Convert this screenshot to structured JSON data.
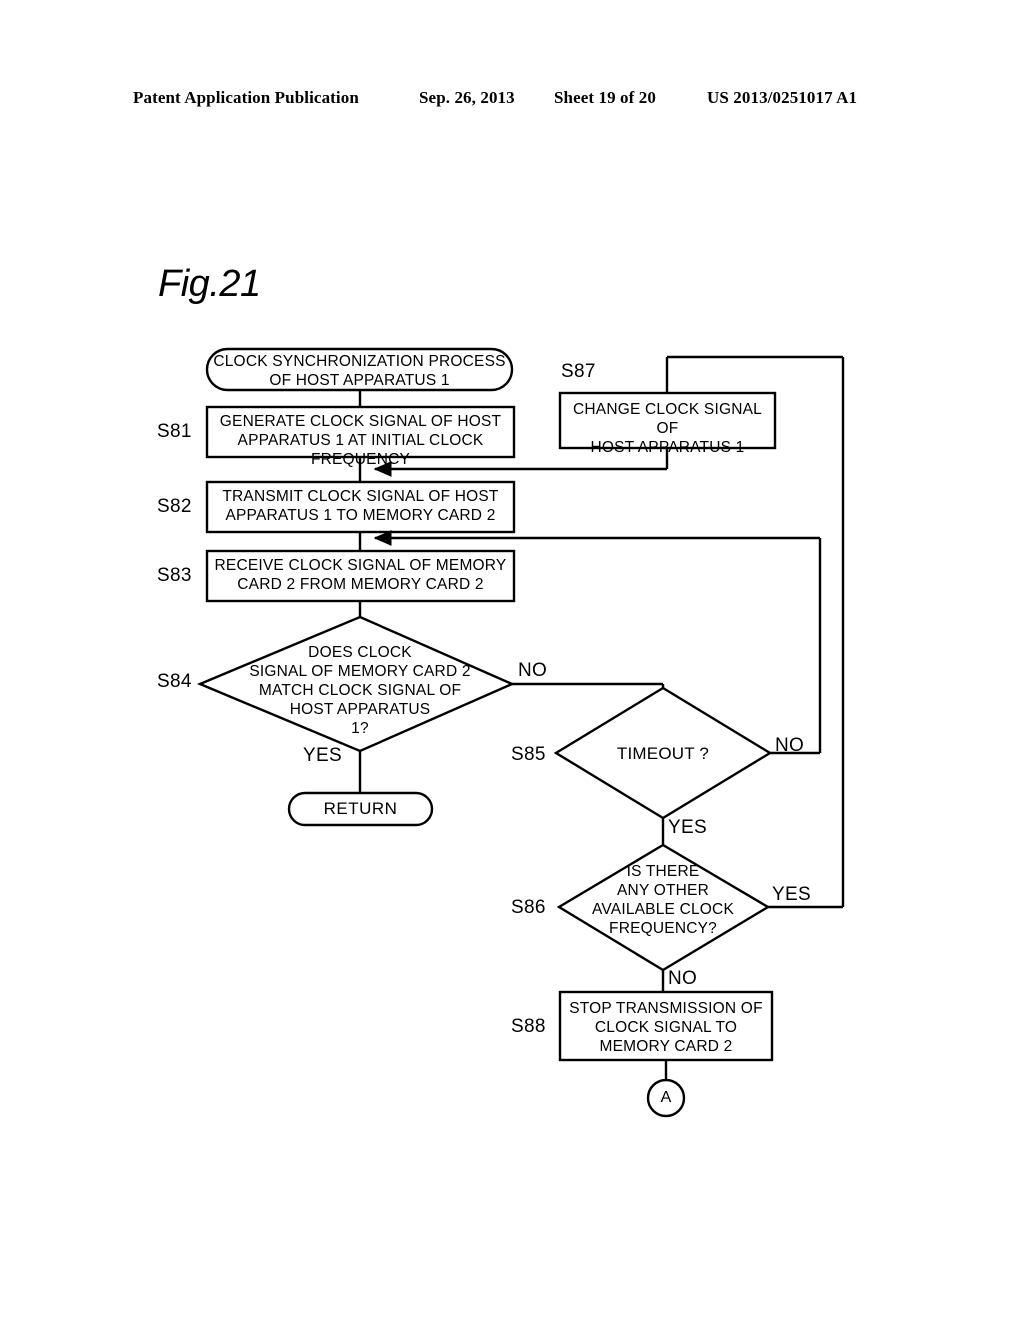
{
  "header": {
    "publication": "Patent Application Publication",
    "date": "Sep. 26, 2013",
    "sheet": "Sheet 19 of 20",
    "number": "US 2013/0251017 A1"
  },
  "figure": {
    "title": "Fig.21"
  },
  "flowchart": {
    "nodes": {
      "start": {
        "shape": "terminal",
        "text": "CLOCK SYNCHRONIZATION PROCESS\nOF HOST APPARATUS 1"
      },
      "s81": {
        "shape": "process",
        "step": "S81",
        "text": "GENERATE CLOCK SIGNAL OF HOST\nAPPARATUS 1 AT INITIAL CLOCK FREQUENCY"
      },
      "s82": {
        "shape": "process",
        "step": "S82",
        "text": "TRANSMIT CLOCK SIGNAL OF HOST\nAPPARATUS 1 TO MEMORY CARD 2"
      },
      "s83": {
        "shape": "process",
        "step": "S83",
        "text": "RECEIVE CLOCK SIGNAL OF MEMORY\nCARD 2 FROM MEMORY CARD 2"
      },
      "s84": {
        "shape": "decision",
        "step": "S84",
        "text": "DOES CLOCK\nSIGNAL OF MEMORY CARD 2\nMATCH CLOCK SIGNAL OF\nHOST APPARATUS\n1?"
      },
      "s85": {
        "shape": "decision",
        "step": "S85",
        "text": "TIMEOUT ?"
      },
      "s86": {
        "shape": "decision",
        "step": "S86",
        "text": "IS THERE\nANY OTHER\nAVAILABLE CLOCK\nFREQUENCY?"
      },
      "s87": {
        "shape": "process",
        "step": "S87",
        "text": "CHANGE CLOCK SIGNAL OF\nHOST APPARATUS 1"
      },
      "s88": {
        "shape": "process",
        "step": "S88",
        "text": "STOP TRANSMISSION OF\nCLOCK SIGNAL TO\nMEMORY CARD 2"
      },
      "return": {
        "shape": "terminal",
        "text": "RETURN"
      },
      "connector_a": {
        "shape": "circle",
        "text": "A"
      }
    },
    "edge_labels": {
      "s84_yes": "YES",
      "s84_no": "NO",
      "s85_yes": "YES",
      "s85_no": "NO",
      "s86_yes": "YES",
      "s86_no": "NO"
    }
  },
  "colors": {
    "ink": "#000000",
    "paper": "#ffffff"
  }
}
